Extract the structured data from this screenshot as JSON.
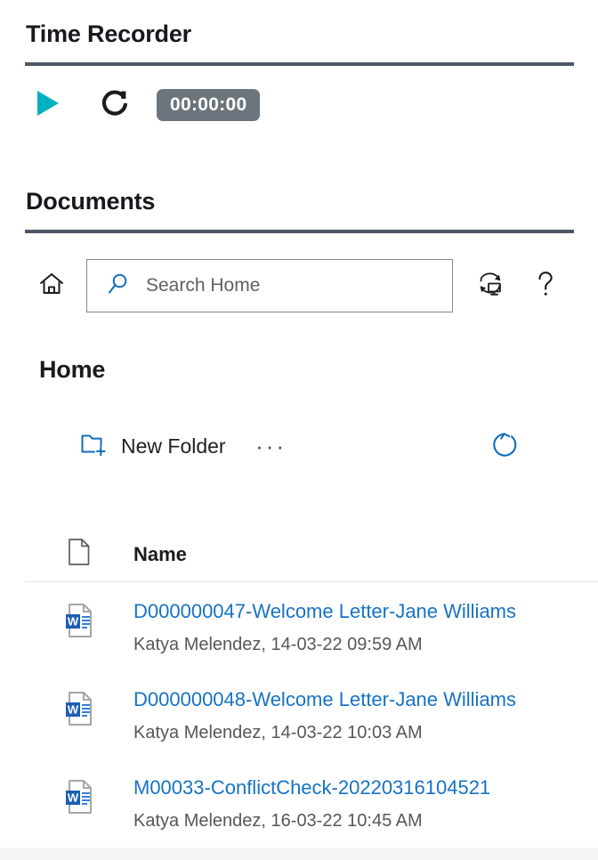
{
  "time_recorder": {
    "title": "Time Recorder",
    "play_label": "play-icon",
    "reset_label": "reset-icon",
    "timer_value": "00:00:00",
    "accent_color": "#00b0c0",
    "timer_badge_color": "#6c757d",
    "rule_color": "#4e5767"
  },
  "documents": {
    "title": "Documents",
    "toolbar": {
      "home_icon": "home-icon",
      "sync_icon": "sync-to-desktop-icon",
      "help_icon": "help-question-icon"
    },
    "search": {
      "placeholder": "Search Home",
      "value": "",
      "icon": "search-icon",
      "icon_color": "#0f6cbd"
    },
    "breadcrumb": "Home",
    "command_bar": {
      "new_folder_label": "New Folder",
      "new_folder_icon": "new-folder-icon",
      "more_label": "···",
      "refresh_icon": "refresh-icon",
      "accent_color": "#0f6cbd"
    },
    "list": {
      "columns": {
        "icon_header": "document-type-icon",
        "name_header": "Name"
      },
      "rows": [
        {
          "file_icon": "word-document-icon",
          "name": "D000000047-Welcome Letter-Jane Williams",
          "meta": "Katya Melendez, 14-03-22 09:59 AM"
        },
        {
          "file_icon": "word-document-icon",
          "name": "D000000048-Welcome Letter-Jane Williams",
          "meta": "Katya Melendez, 14-03-22 10:03 AM"
        },
        {
          "file_icon": "word-document-icon",
          "name": "M00033-ConflictCheck-20220316104521",
          "meta": "Katya Melendez, 16-03-22 10:45 AM"
        }
      ]
    }
  }
}
